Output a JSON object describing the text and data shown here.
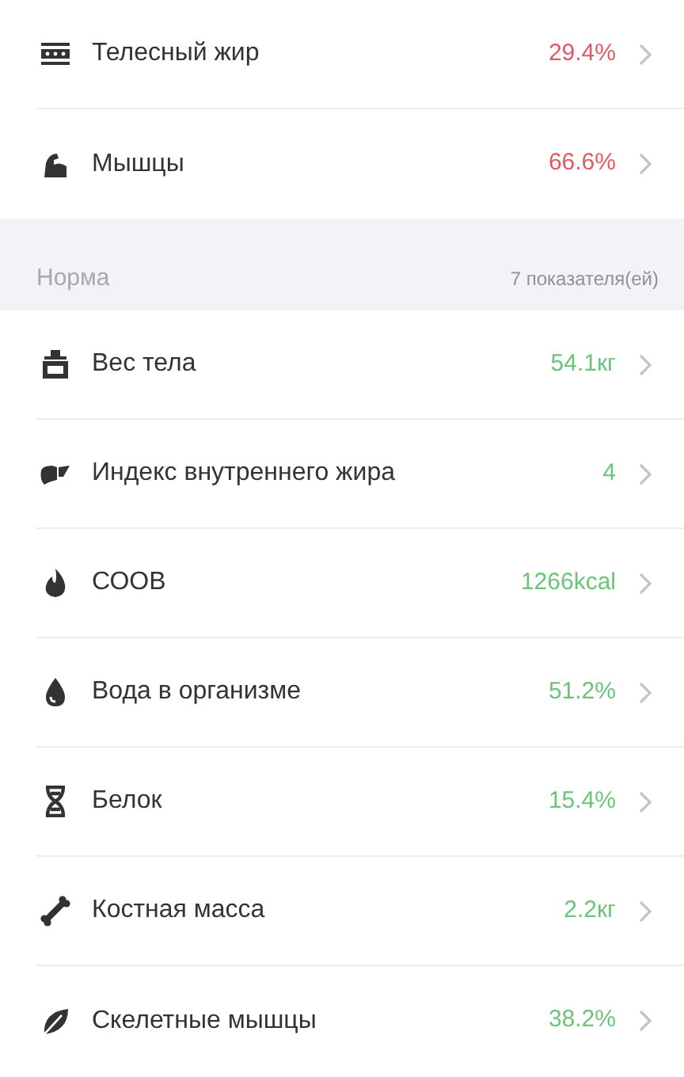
{
  "sections": [
    {
      "rows": [
        {
          "label": "Телесный жир",
          "value": "29.4%",
          "color": "#e05a63"
        },
        {
          "label": "Мышцы",
          "value": "66.6%",
          "color": "#e05a63"
        }
      ]
    },
    {
      "header": {
        "title": "Норма",
        "count": "7 показателя(ей)"
      },
      "rows": [
        {
          "label": "Вес тела",
          "value": "54.1кг",
          "color": "#6cc47a"
        },
        {
          "label": "Индекс внутреннего жира",
          "value": "4",
          "color": "#6cc47a"
        },
        {
          "label": "СООВ",
          "value": "1266kcal",
          "color": "#6cc47a"
        },
        {
          "label": "Вода в организме",
          "value": "51.2%",
          "color": "#6cc47a"
        },
        {
          "label": "Белок",
          "value": "15.4%",
          "color": "#6cc47a"
        },
        {
          "label": "Костная масса",
          "value": "2.2кг",
          "color": "#6cc47a"
        },
        {
          "label": "Скелетные мышцы",
          "value": "38.2%",
          "color": "#6cc47a"
        }
      ]
    }
  ]
}
